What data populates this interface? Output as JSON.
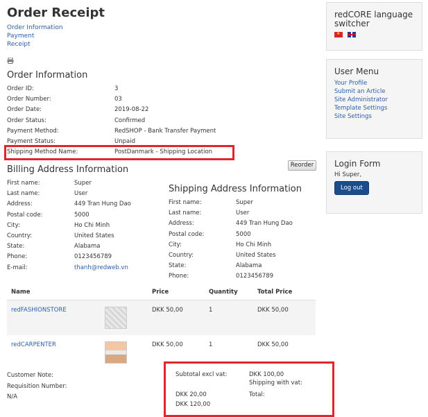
{
  "page": {
    "title": "Order Receipt",
    "toc": [
      "Order Information",
      "Payment",
      "Receipt"
    ],
    "print_icon": "printer-icon"
  },
  "order_info": {
    "heading": "Order Information",
    "rows": [
      {
        "label": "Order ID:",
        "value": "3"
      },
      {
        "label": "Order Number:",
        "value": "03"
      },
      {
        "label": "Order Date:",
        "value": "2019-08-22"
      },
      {
        "label": "Order Status:",
        "value": "Confirmed"
      },
      {
        "label": "Payment Method:",
        "value": "RedSHOP - Bank Transfer Payment"
      },
      {
        "label": "Payment Status:",
        "value": "Unpaid"
      },
      {
        "label": "Shipping Method Name:",
        "value": "PostDanmark - Shipping Location"
      }
    ],
    "reorder_label": "Reorder"
  },
  "billing": {
    "heading": "Billing Address Information",
    "rows": [
      {
        "label": "First name:",
        "value": "Super"
      },
      {
        "label": "Last name:",
        "value": "User"
      },
      {
        "label": "Address:",
        "value": "449 Tran Hung Dao"
      },
      {
        "label": "Postal code:",
        "value": "5000"
      },
      {
        "label": "City:",
        "value": "Ho Chi Minh"
      },
      {
        "label": "Country:",
        "value": "United States"
      },
      {
        "label": "State:",
        "value": "Alabama"
      },
      {
        "label": "Phone:",
        "value": "0123456789"
      },
      {
        "label": "E-mail:",
        "value": "thanh@redweb.vn"
      }
    ]
  },
  "shipping": {
    "heading": "Shipping Address Information",
    "rows": [
      {
        "label": "First name:",
        "value": "Super"
      },
      {
        "label": "Last name:",
        "value": "User"
      },
      {
        "label": "Address:",
        "value": "449 Tran Hung Dao"
      },
      {
        "label": "Postal code:",
        "value": "5000"
      },
      {
        "label": "City:",
        "value": "Ho Chi Minh"
      },
      {
        "label": "Country:",
        "value": "United States"
      },
      {
        "label": "State:",
        "value": "Alabama"
      },
      {
        "label": "Phone:",
        "value": "0123456789"
      }
    ]
  },
  "items": {
    "columns": [
      "Name",
      "",
      "Price",
      "Quantity",
      "Total Price"
    ],
    "rows": [
      {
        "name": "redFASHIONSTORE",
        "price": "DKK 50,00",
        "quantity": "1",
        "total": "DKK 50,00"
      },
      {
        "name": "redCARPENTER",
        "price": "DKK 50,00",
        "quantity": "1",
        "total": "DKK 50,00"
      }
    ]
  },
  "notes": {
    "customer_note": "Customer Note:",
    "requisition": "Requisition Number:",
    "requisition_value": "N/A"
  },
  "totals": {
    "subtotal_label": "Subtotal excl vat:",
    "subtotal_value": "DKK 100,00",
    "shipping_label": "Shipping with vat:",
    "shipping_value": "DKK 20,00",
    "total_label": "Total:",
    "total_value": "DKK 120,00"
  },
  "sidebar": {
    "lang_title": "redCORE language switcher",
    "user_menu_title": "User Menu",
    "user_menu_items": [
      "Your Profile",
      "Submit an Article",
      "Site Administrator",
      "Template Settings",
      "Site Settings"
    ],
    "login_title": "Login Form",
    "greeting": "Hi Super,",
    "logout_label": "Log out"
  },
  "colors": {
    "highlight": "#e0252e",
    "link": "#2a5ea8",
    "button": "#1c4c8c"
  }
}
